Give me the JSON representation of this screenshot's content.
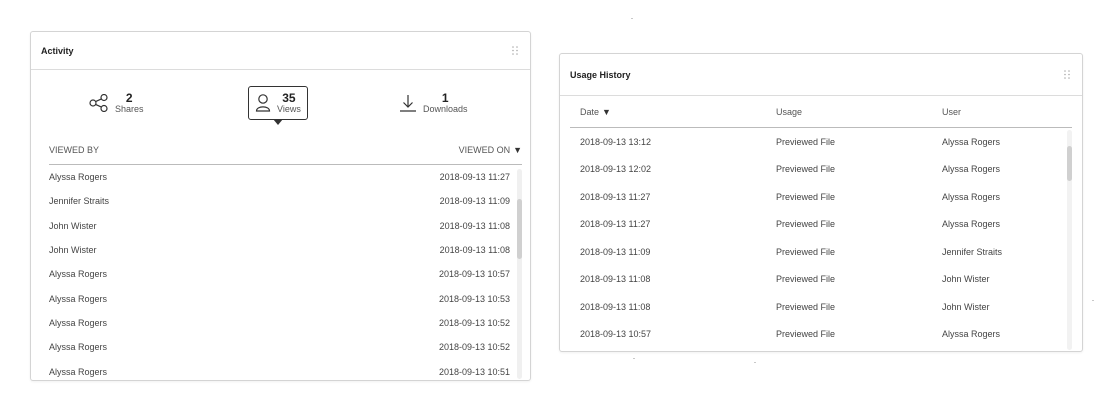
{
  "activity": {
    "title": "Activity",
    "stats": [
      {
        "icon": "share-icon",
        "count": "2",
        "label": "Shares"
      },
      {
        "icon": "user-icon",
        "count": "35",
        "label": "Views"
      },
      {
        "icon": "download-icon",
        "count": "1",
        "label": "Downloads"
      }
    ],
    "columns": {
      "viewed_by": "VIEWED BY",
      "viewed_on": "VIEWED ON"
    },
    "rows": [
      {
        "name": "Alyssa Rogers",
        "time": "2018-09-13 11:27"
      },
      {
        "name": "Jennifer Straits",
        "time": "2018-09-13 11:09"
      },
      {
        "name": "John Wister",
        "time": "2018-09-13 11:08"
      },
      {
        "name": "John Wister",
        "time": "2018-09-13 11:08"
      },
      {
        "name": "Alyssa Rogers",
        "time": "2018-09-13 10:57"
      },
      {
        "name": "Alyssa Rogers",
        "time": "2018-09-13 10:53"
      },
      {
        "name": "Alyssa Rogers",
        "time": "2018-09-13 10:52"
      },
      {
        "name": "Alyssa Rogers",
        "time": "2018-09-13 10:52"
      },
      {
        "name": "Alyssa Rogers",
        "time": "2018-09-13 10:51"
      }
    ]
  },
  "usage": {
    "title": "Usage History",
    "columns": {
      "date": "Date",
      "usage": "Usage",
      "user": "User"
    },
    "rows": [
      {
        "date": "2018-09-13 13:12",
        "usage": "Previewed File",
        "user": "Alyssa Rogers"
      },
      {
        "date": "2018-09-13 12:02",
        "usage": "Previewed File",
        "user": "Alyssa Rogers"
      },
      {
        "date": "2018-09-13 11:27",
        "usage": "Previewed File",
        "user": "Alyssa Rogers"
      },
      {
        "date": "2018-09-13 11:27",
        "usage": "Previewed File",
        "user": "Alyssa Rogers"
      },
      {
        "date": "2018-09-13 11:09",
        "usage": "Previewed File",
        "user": "Jennifer Straits"
      },
      {
        "date": "2018-09-13 11:08",
        "usage": "Previewed File",
        "user": "John Wister"
      },
      {
        "date": "2018-09-13 11:08",
        "usage": "Previewed File",
        "user": "John Wister"
      },
      {
        "date": "2018-09-13 10:57",
        "usage": "Previewed File",
        "user": "Alyssa Rogers"
      }
    ]
  }
}
